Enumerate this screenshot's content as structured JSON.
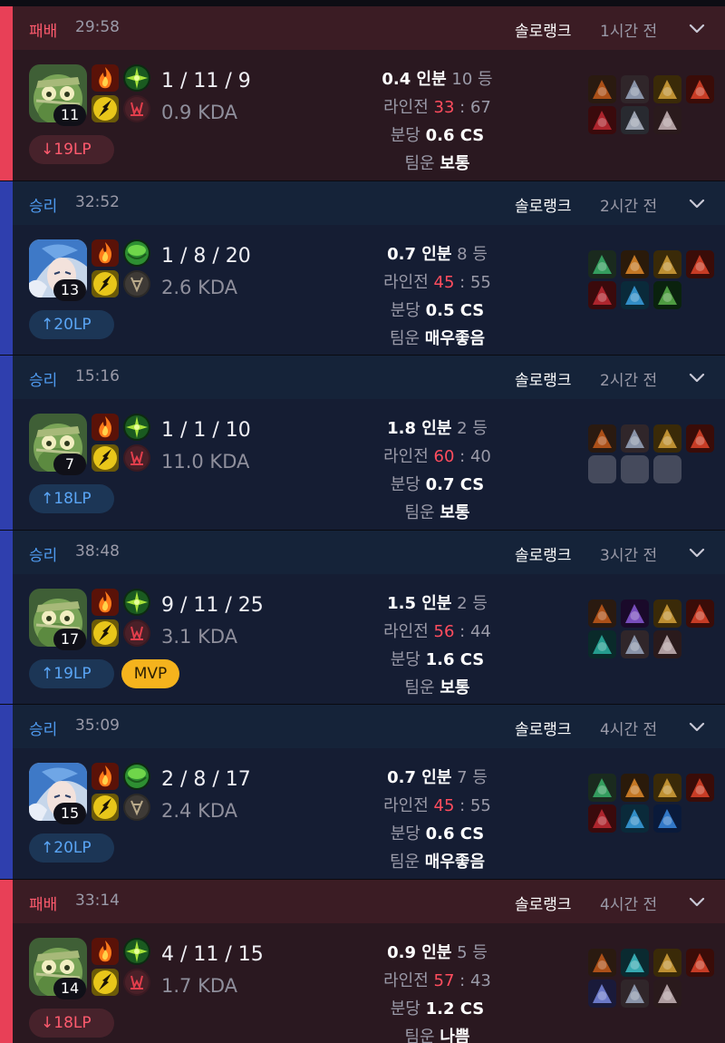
{
  "matches": [
    {
      "outcome": "loss",
      "result": "패배",
      "duration": "29:58",
      "queue": "솔로랭크",
      "ago": "1시간 전",
      "champion": "amumu",
      "level": "11",
      "spells": [
        "ignite-icon",
        "flash-icon"
      ],
      "runes": [
        "aftershock-icon",
        "domination-tree-icon"
      ],
      "kda": "1 / 11 / 9",
      "kda_ratio": "0.9 KDA",
      "lp": "19LP",
      "lp_dir": "down",
      "mvp": "",
      "share_value": "0.4 인분",
      "rank": "10 등",
      "lane_label": "라인전",
      "lane_a": "33",
      "lane_sep": " : ",
      "lane_b": "67",
      "cs_label": "분당",
      "cs_value": "0.6 CS",
      "luck_label": "팀운",
      "luck_value": "보통",
      "items": [
        "a",
        "b",
        "c",
        "d",
        "e",
        "f",
        "g"
      ]
    },
    {
      "outcome": "win",
      "result": "승리",
      "duration": "32:52",
      "queue": "솔로랭크",
      "ago": "2시간 전",
      "champion": "irelia",
      "level": "13",
      "spells": [
        "ignite-icon",
        "flash-icon"
      ],
      "runes": [
        "conqueror-icon",
        "resolve-tree-icon"
      ],
      "kda": "1 / 8 / 20",
      "kda_ratio": "2.6 KDA",
      "lp": "20LP",
      "lp_dir": "up",
      "mvp": "",
      "share_value": "0.7 인분",
      "rank": "8 등",
      "lane_label": "라인전",
      "lane_a": "45",
      "lane_sep": " : ",
      "lane_b": "55",
      "cs_label": "분당",
      "cs_value": "0.5 CS",
      "luck_label": "팀운",
      "luck_value": "매우좋음",
      "items": [
        "h",
        "i",
        "c",
        "d",
        "e",
        "j",
        "k"
      ]
    },
    {
      "outcome": "win",
      "result": "승리",
      "duration": "15:16",
      "queue": "솔로랭크",
      "ago": "2시간 전",
      "champion": "amumu",
      "level": "7",
      "spells": [
        "ignite-icon",
        "flash-icon"
      ],
      "runes": [
        "aftershock-icon",
        "domination-tree-icon"
      ],
      "kda": "1 / 1 / 10",
      "kda_ratio": "11.0 KDA",
      "lp": "18LP",
      "lp_dir": "up",
      "mvp": "",
      "share_value": "1.8 인분",
      "rank": "2 등",
      "lane_label": "라인전",
      "lane_a": "60",
      "lane_sep": " : ",
      "lane_b": "40",
      "cs_label": "분당",
      "cs_value": "0.7 CS",
      "luck_label": "팀운",
      "luck_value": "보통",
      "items": [
        "a",
        "b",
        "c",
        "d",
        "empty",
        "empty",
        "empty"
      ]
    },
    {
      "outcome": "win",
      "result": "승리",
      "duration": "38:48",
      "queue": "솔로랭크",
      "ago": "3시간 전",
      "champion": "amumu",
      "level": "17",
      "spells": [
        "ignite-icon",
        "flash-icon"
      ],
      "runes": [
        "aftershock-icon",
        "domination-tree-icon"
      ],
      "kda": "9 / 11 / 25",
      "kda_ratio": "3.1 KDA",
      "lp": "19LP",
      "lp_dir": "up",
      "mvp": "MVP",
      "share_value": "1.5 인분",
      "rank": "2 등",
      "lane_label": "라인전",
      "lane_a": "56",
      "lane_sep": " : ",
      "lane_b": "44",
      "cs_label": "분당",
      "cs_value": "1.6 CS",
      "luck_label": "팀운",
      "luck_value": "보통",
      "items": [
        "a",
        "l",
        "c",
        "d",
        "m",
        "b",
        "g"
      ]
    },
    {
      "outcome": "win",
      "result": "승리",
      "duration": "35:09",
      "queue": "솔로랭크",
      "ago": "4시간 전",
      "champion": "irelia",
      "level": "15",
      "spells": [
        "ignite-icon",
        "flash-icon"
      ],
      "runes": [
        "conqueror-icon",
        "resolve-tree-icon"
      ],
      "kda": "2 / 8 / 17",
      "kda_ratio": "2.4 KDA",
      "lp": "20LP",
      "lp_dir": "up",
      "mvp": "",
      "share_value": "0.7 인분",
      "rank": "7 등",
      "lane_label": "라인전",
      "lane_a": "45",
      "lane_sep": " : ",
      "lane_b": "55",
      "cs_label": "분당",
      "cs_value": "0.6 CS",
      "luck_label": "팀운",
      "luck_value": "매우좋음",
      "items": [
        "h",
        "i",
        "c",
        "d",
        "e",
        "j",
        "n"
      ]
    },
    {
      "outcome": "loss",
      "result": "패배",
      "duration": "33:14",
      "queue": "솔로랭크",
      "ago": "4시간 전",
      "champion": "amumu",
      "level": "14",
      "spells": [
        "ignite-icon",
        "flash-icon"
      ],
      "runes": [
        "aftershock-icon",
        "domination-tree-icon"
      ],
      "kda": "4 / 11 / 15",
      "kda_ratio": "1.7 KDA",
      "lp": "18LP",
      "lp_dir": "down",
      "mvp": "",
      "share_value": "0.9 인분",
      "rank": "5 등",
      "lane_label": "라인전",
      "lane_a": "57",
      "lane_sep": " : ",
      "lane_b": "43",
      "cs_label": "분당",
      "cs_value": "1.2 CS",
      "luck_label": "팀운",
      "luck_value": "나쁨",
      "items": [
        "a",
        "o",
        "c",
        "d",
        "p",
        "b",
        "g"
      ]
    }
  ]
}
